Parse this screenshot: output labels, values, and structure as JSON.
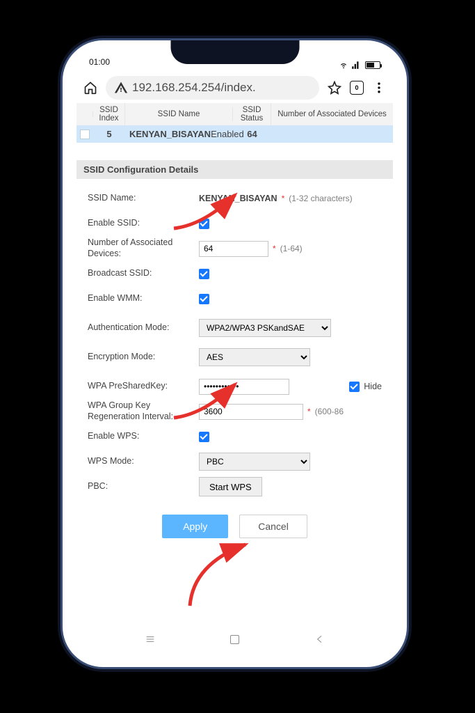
{
  "status": {
    "time": "01:00",
    "tab_count": "0"
  },
  "url": {
    "text": "192.168.254.254/index."
  },
  "table": {
    "headers": {
      "c1": "",
      "c2": "SSID Index",
      "c3": "SSID Name",
      "c4": "SSID Status",
      "c5": "Number of Associated Devices"
    },
    "row": {
      "index": "5",
      "name": "KENYAN_BISAYAN",
      "status": "Enabled",
      "devices": "64"
    }
  },
  "section_title": "SSID Configuration Details",
  "form": {
    "ssid_name_lbl": "SSID Name:",
    "ssid_name_val": "KENYAN_BISAYAN",
    "ssid_name_hint": "(1-32 characters)",
    "enable_ssid_lbl": "Enable SSID:",
    "num_assoc_lbl": "Number of Associated Devices:",
    "num_assoc_val": "64",
    "num_assoc_hint": "(1-64)",
    "broadcast_lbl": "Broadcast SSID:",
    "wmm_lbl": "Enable WMM:",
    "auth_lbl": "Authentication Mode:",
    "auth_val": "WPA2/WPA3 PSKandSAE",
    "enc_lbl": "Encryption Mode:",
    "enc_val": "AES",
    "key_lbl": "WPA PreSharedKey:",
    "key_val": "••••••••••••",
    "hide_lbl": "Hide",
    "grp_lbl": "WPA Group Key Regeneration Interval:",
    "grp_val": "3600",
    "grp_hint": "(600-86",
    "wps_lbl": "Enable WPS:",
    "wps_mode_lbl": "WPS Mode:",
    "wps_mode_val": "PBC",
    "pbc_lbl": "PBC:",
    "pbc_btn": "Start WPS"
  },
  "buttons": {
    "apply": "Apply",
    "cancel": "Cancel"
  }
}
